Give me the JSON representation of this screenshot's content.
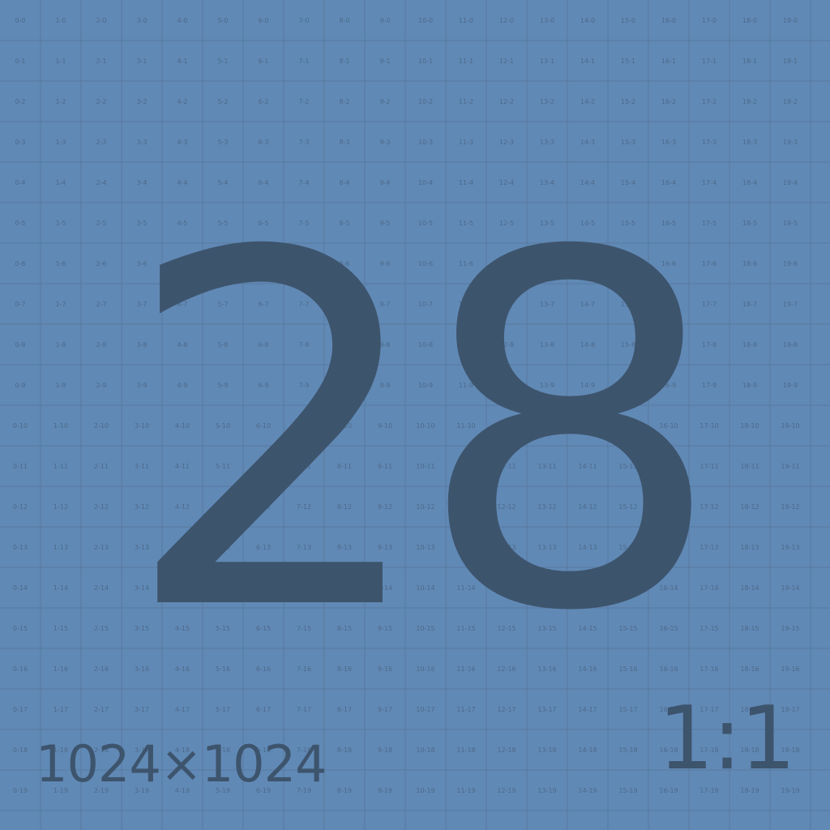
{
  "placeholder": {
    "number": "28",
    "dimensions": "1024×1024",
    "ratio": "1:1"
  },
  "grid": {
    "columns": 20,
    "rows": 20
  },
  "colors": {
    "background": "#6189b5",
    "grid_line": "#56799f",
    "cell_label": "#4c6a8b",
    "foreground": "#3d546d"
  }
}
